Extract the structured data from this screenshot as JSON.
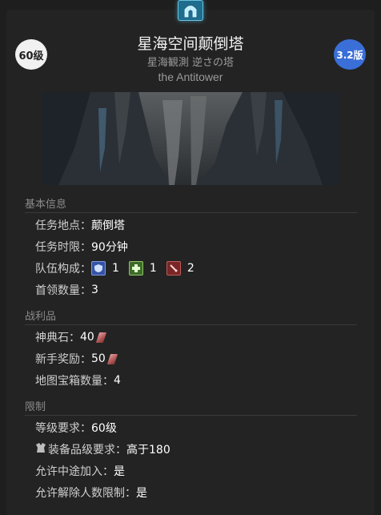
{
  "header": {
    "level_badge": "60级",
    "version_badge": "3.2版",
    "title": "星海空间颠倒塔",
    "subtitle_jp": "星海観測 逆さの塔",
    "subtitle_en": "the Antitower",
    "icon": "dungeon-icon"
  },
  "basic_info": {
    "header": "基本信息",
    "location_label": "任务地点：",
    "location_value": "颠倒塔",
    "time_label": "任务时限：",
    "time_value": "90分钟",
    "party_label": "队伍构成：",
    "party": [
      {
        "role": "tank",
        "icon": "shield-icon",
        "count": "1",
        "color": "#3553a6"
      },
      {
        "role": "healer",
        "icon": "healer-cross-icon",
        "count": "1",
        "color": "#3f6b2a"
      },
      {
        "role": "dps",
        "icon": "sword-icon",
        "count": "2",
        "color": "#7a2626"
      }
    ],
    "boss_label": "首领数量：",
    "boss_value": "3"
  },
  "loot": {
    "header": "战利品",
    "tomestone_label": "神典石：",
    "tomestone_value": "40",
    "novice_label": "新手奖励：",
    "novice_value": "50",
    "map_chest_label": "地图宝箱数量：",
    "map_chest_value": "4"
  },
  "restrictions": {
    "header": "限制",
    "level_label": "等级要求：",
    "level_value": "60级",
    "ilvl_label": "装备品级要求：",
    "ilvl_value": "高于180",
    "join_label": "允许中途加入：",
    "join_value": "是",
    "unrestricted_label": "允许解除人数限制：",
    "unrestricted_value": "是"
  },
  "colors": {
    "background": "#1e1e1e",
    "card": "#232323",
    "version_badge": "#3a6fd8",
    "level_badge": "#f1f1f1"
  }
}
